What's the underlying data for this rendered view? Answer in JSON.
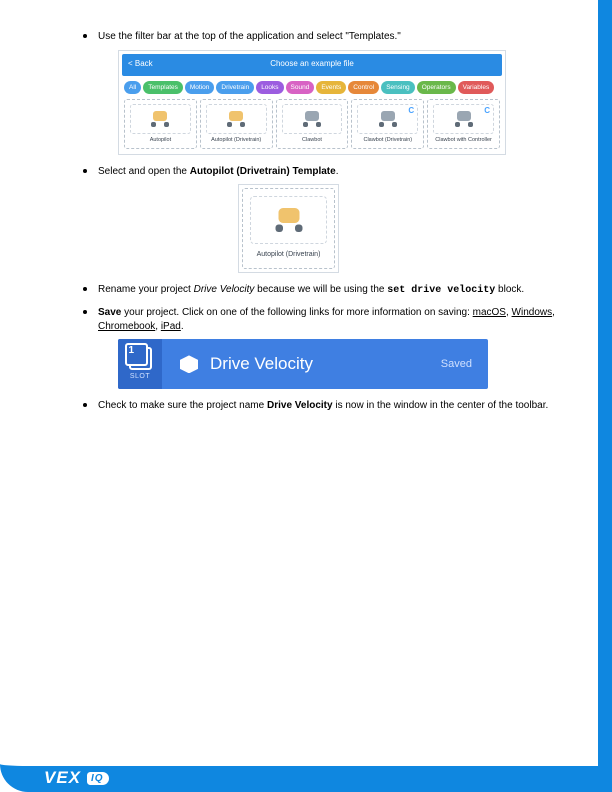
{
  "bullets": {
    "b1_pre": "Use the filter bar at the top of the application and select \"Templates.\"",
    "b2_pre": "Select and open the ",
    "b2_bold": "Autopilot (Drivetrain) Template",
    "b2_post": ".",
    "b3_pre": "Rename your project ",
    "b3_ital": "Drive Velocity",
    "b3_mid": " because we will be using the ",
    "b3_code": "set drive velocity",
    "b3_post": " block.",
    "b4_bold": "Save",
    "b4_pre": " your project. Click on one of the following links for more information on saving: ",
    "b4_link1": "macOS",
    "b4_link2": "Windows",
    "b4_link3": "Chromebook",
    "b4_link4": "iPad",
    "b4_comma": ", ",
    "b4_dot": ".",
    "b5_pre": "Check to make sure the project name ",
    "b5_bold": "Drive Velocity",
    "b5_post": " is now in the window in the center of the toolbar."
  },
  "filterbar": {
    "back": "< Back",
    "title": "Choose an example file",
    "cats": [
      {
        "label": "All",
        "color": "#4a9eed"
      },
      {
        "label": "Templates",
        "color": "#4ac06a"
      },
      {
        "label": "Motion",
        "color": "#4a9eed"
      },
      {
        "label": "Drivetrain",
        "color": "#4a9eed"
      },
      {
        "label": "Looks",
        "color": "#9c5de0"
      },
      {
        "label": "Sound",
        "color": "#d862c4"
      },
      {
        "label": "Events",
        "color": "#e6b53a"
      },
      {
        "label": "Control",
        "color": "#e6883a"
      },
      {
        "label": "Sensing",
        "color": "#4ac0c0"
      },
      {
        "label": "Operators",
        "color": "#6ab84a"
      },
      {
        "label": "Variables",
        "color": "#e05a5a"
      }
    ],
    "cards": [
      {
        "label": "Autopilot",
        "gray": false,
        "c": false
      },
      {
        "label": "Autopilot (Drivetrain)",
        "gray": false,
        "c": false
      },
      {
        "label": "Clawbot",
        "gray": true,
        "c": false
      },
      {
        "label": "Clawbot (Drivetrain)",
        "gray": true,
        "c": true
      },
      {
        "label": "Clawbot with Controller",
        "gray": true,
        "c": true
      }
    ]
  },
  "single_card": {
    "label": "Autopilot (Drivetrain)"
  },
  "toolbar": {
    "slot_num": "1",
    "slot_label": "SLOT",
    "title": "Drive Velocity",
    "saved": "Saved"
  },
  "logo": {
    "vex": "VEX",
    "iq": "IQ"
  }
}
